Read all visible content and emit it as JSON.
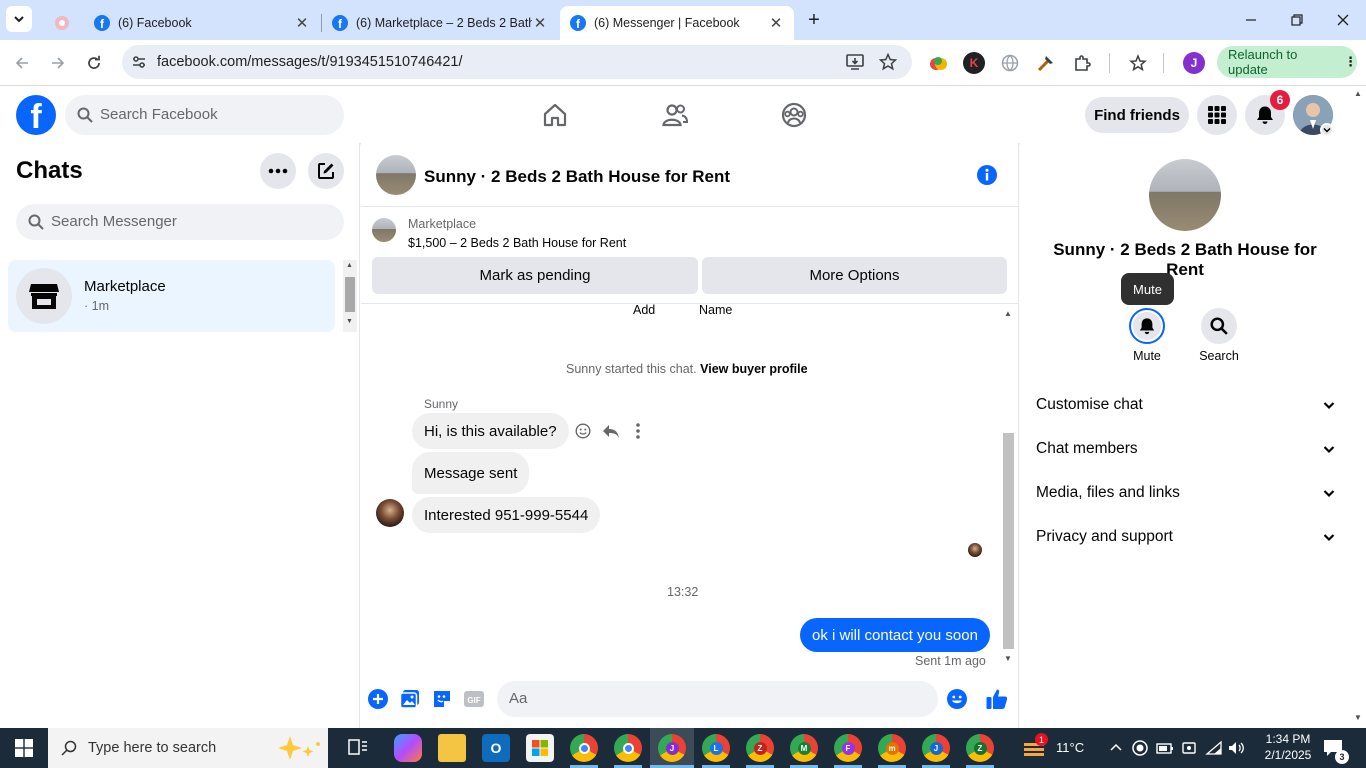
{
  "browser": {
    "tabs": [
      {
        "title": "(6) Facebook"
      },
      {
        "title": "(6) Marketplace – 2 Beds 2 Bath"
      },
      {
        "title": "(6) Messenger | Facebook"
      }
    ],
    "url": "facebook.com/messages/t/9193451510746421/",
    "relaunch_label": "Relaunch to update",
    "ext_k_label": "K",
    "profile_initial": "J"
  },
  "fb_header": {
    "logo": "f",
    "search_placeholder": "Search Facebook",
    "find_friends_label": "Find friends",
    "notification_count": "6"
  },
  "chats": {
    "title": "Chats",
    "search_placeholder": "Search Messenger",
    "items": [
      {
        "name": "Marketplace",
        "time": "· 1m"
      }
    ]
  },
  "conversation": {
    "title": "Sunny · 2 Beds 2 Bath House for Rent",
    "marketplace_label": "Marketplace",
    "listing": "$1,500 – 2 Beds 2 Bath House for Rent",
    "mark_pending_label": "Mark as pending",
    "more_options_label": "More Options",
    "cut_labels": {
      "add": "Add",
      "name": "Name"
    },
    "started_text": "Sunny started this chat.",
    "view_profile_label": "View buyer profile",
    "sender_name": "Sunny",
    "messages_in": [
      "Hi, is this available?",
      "Message sent",
      "Interested 951-999-5544"
    ],
    "timestamp": "13:32",
    "message_out": "ok i will contact you soon",
    "sent_status": "Sent 1m ago",
    "composer_placeholder": "Aa"
  },
  "info_panel": {
    "name": "Sunny · 2 Beds 2 Bath House for Rent",
    "tooltip": "Mute",
    "mute_label": "Mute",
    "search_label": "Search",
    "sections": [
      "Customise chat",
      "Chat members",
      "Media, files and links",
      "Privacy and support"
    ]
  },
  "taskbar": {
    "search_placeholder": "Type here to search",
    "weather": "11°C",
    "weather_badge": "1",
    "time": "1:34 PM",
    "date": "2/1/2025",
    "notification_count": "3",
    "app_letters": [
      "J",
      "L",
      "Z",
      "M",
      "F",
      "m",
      "J",
      "Z"
    ]
  },
  "colors": {
    "fb_blue": "#0866ff",
    "chrome_tabbar": "#d3e3fd",
    "selected_chat_bg": "#ebf5ff",
    "taskbar_bg": "#1c2b3a"
  }
}
